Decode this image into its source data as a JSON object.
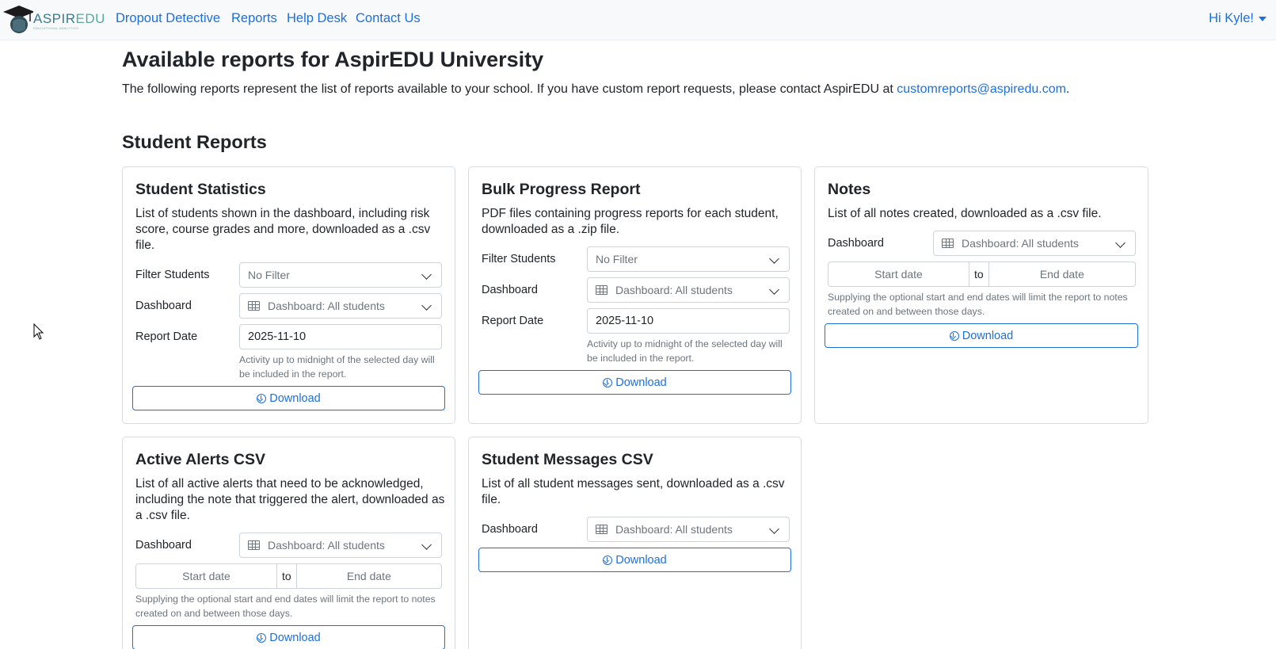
{
  "navbar": {
    "brand": {
      "text_a": "ASPIR",
      "text_b": "EDU",
      "sub": "EDUCATIONAL ANALYTICS"
    },
    "links": [
      "Dropout Detective",
      "Reports",
      "Help Desk",
      "Contact Us"
    ],
    "user": "Hi Kyle!"
  },
  "page": {
    "title": "Available reports for AspirEDU University",
    "intro": "The following reports represent the list of reports available to your school. If you have custom report requests, please contact AspirEDU at ",
    "email": "customreports@aspiredu.com",
    "intro_end": ".",
    "section": "Student Reports"
  },
  "labels": {
    "filter": "Filter Students",
    "dashboard": "Dashboard",
    "report_date": "Report Date",
    "start": "Start date",
    "to": "to",
    "end": "End date",
    "download": "Download",
    "no_filter": "No Filter",
    "dashboard_value": "Dashboard: All students",
    "date_value": "2025-11-10",
    "date_help": "Activity up to midnight of the selected day will be included in the report.",
    "range_help": "Supplying the optional start and end dates will limit the report to notes created on and between those days."
  },
  "cards": {
    "stats": {
      "title": "Student Statistics",
      "desc": "List of students shown in the dashboard, including risk score, course grades and more, downloaded as a .csv file."
    },
    "bulk": {
      "title": "Bulk Progress Report",
      "desc": "PDF files containing progress reports for each student, downloaded as a .zip file."
    },
    "notes": {
      "title": "Notes",
      "desc": "List of all notes created, downloaded as a .csv file."
    },
    "alerts": {
      "title": "Active Alerts CSV",
      "desc": "List of all active alerts that need to be acknowledged, including the note that triggered the alert, downloaded as a .csv file."
    },
    "messages": {
      "title": "Student Messages CSV",
      "desc": "List of all student messages sent, downloaded as a .csv file."
    }
  },
  "colors": {
    "link": "#1d6fdf",
    "brand": "#5aa99b"
  }
}
